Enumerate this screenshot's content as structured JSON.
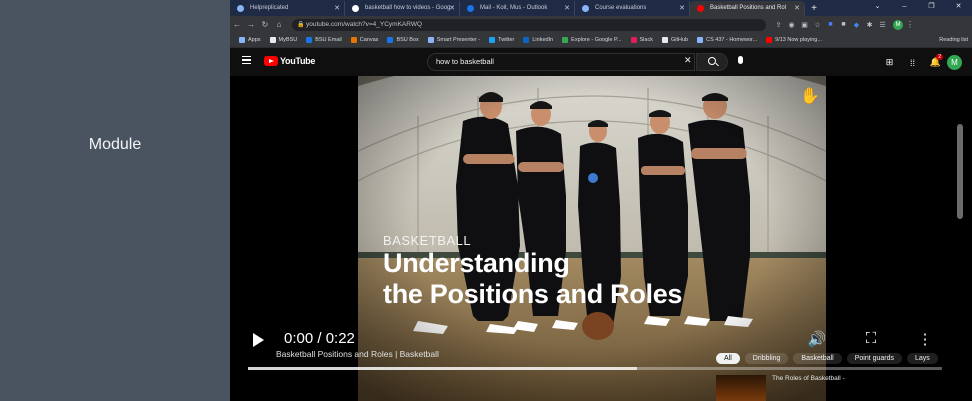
{
  "module": {
    "label": "Module"
  },
  "browser": {
    "tabs": [
      {
        "title": "Helpreplicated",
        "favicon_color": "#8ab4f8"
      },
      {
        "title": "basketball how to videos - Goog",
        "favicon_color": "#ffffff"
      },
      {
        "title": "Mail - Koit, Mus - Outlook",
        "favicon_color": "#1a73e8"
      },
      {
        "title": "Course evaluations",
        "favicon_color": "#8ab4f8"
      },
      {
        "title": "Basketball Positions and Rol",
        "favicon_color": "#ff0000",
        "active": true
      }
    ],
    "new_tab": "+",
    "window_controls": [
      "⌄",
      "–",
      "❐",
      "✕"
    ],
    "url": "youtube.com/watch?v=4_YCymKARWQ",
    "profile_initial": "M",
    "bookmarks": [
      {
        "label": "Apps",
        "color": "#8ab4f8"
      },
      {
        "label": "MyBSU",
        "color": "#e8eaed"
      },
      {
        "label": "BSU Email",
        "color": "#1a73e8"
      },
      {
        "label": "Canvas",
        "color": "#e37400"
      },
      {
        "label": "BSU Box",
        "color": "#1a73e8"
      },
      {
        "label": "Smart Presenter -",
        "color": "#8ab4f8"
      },
      {
        "label": "Twitter",
        "color": "#1da1f2"
      },
      {
        "label": "LinkedIn",
        "color": "#0a66c2"
      },
      {
        "label": "Explore - Google P...",
        "color": "#34a853"
      },
      {
        "label": "Slack",
        "color": "#e01e5a"
      },
      {
        "label": "GitHub",
        "color": "#e8eaed"
      },
      {
        "label": "CS 437 - Homewor...",
        "color": "#8ab4f8"
      },
      {
        "label": "9/13 Now playing...",
        "color": "#ff0000"
      }
    ],
    "reading_list": "Reading list"
  },
  "youtube": {
    "logo_text": "YouTube",
    "search_value": "how to basketball",
    "notifications_badge": "2",
    "avatar_initial": "M",
    "video": {
      "overlay_tag": "BASKETBALL",
      "overlay_title_line1": "Understanding",
      "overlay_title_line2": "the Positions and Roles",
      "time": "0:00 / 0:22",
      "progress_fraction": 0.56,
      "caption": "Basketball Positions and Roles | Basketball"
    },
    "chips": [
      "All",
      "Dribbling",
      "Basketball",
      "Point guards",
      "Lays"
    ],
    "rec_title": "The Roles of Basketball -"
  }
}
